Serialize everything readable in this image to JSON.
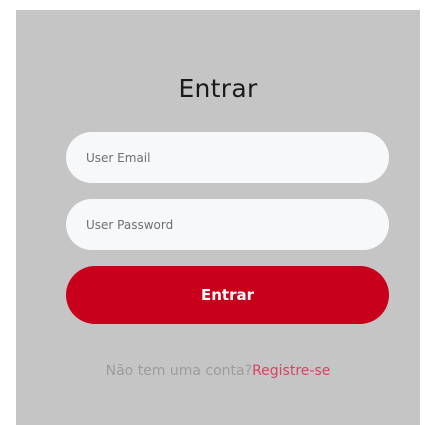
{
  "login": {
    "title": "Entrar",
    "email_placeholder": "User Email",
    "password_placeholder": "User Password",
    "submit_label": "Entrar",
    "footer_prompt": "Não tem uma conta?",
    "register_link": "Registre-se"
  },
  "colors": {
    "card_background": "#c5c5c5",
    "field_background": "#f7f8fa",
    "primary_button": "#c8001c",
    "link": "#d34560"
  }
}
